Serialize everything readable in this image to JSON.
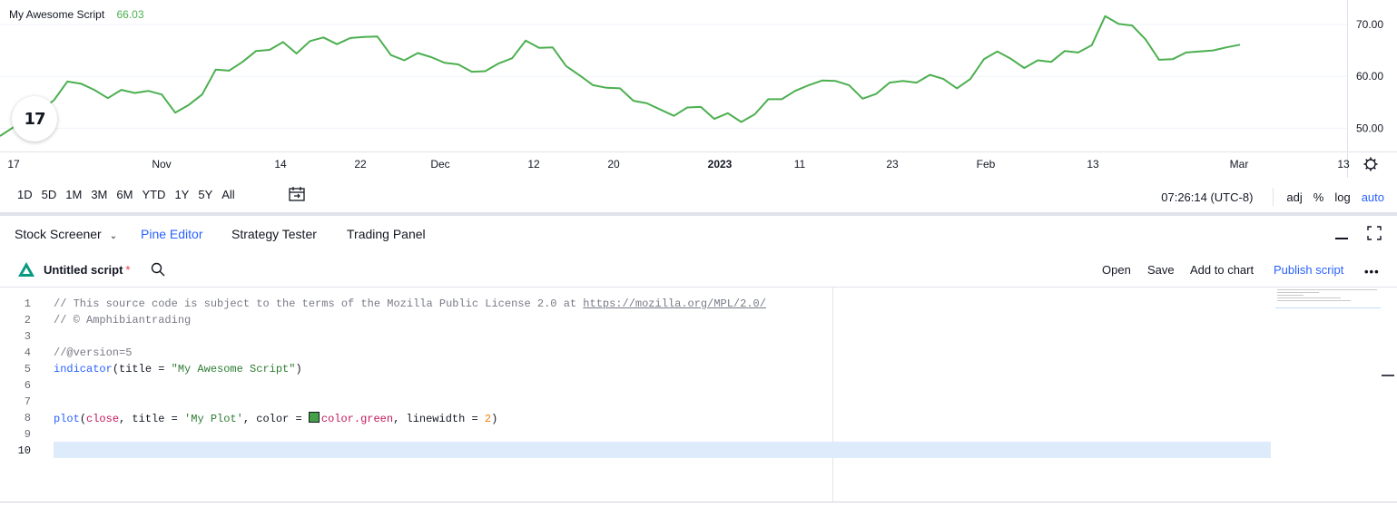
{
  "chart": {
    "indicator_name": "My Awesome Script",
    "indicator_value": "66.03",
    "line_color": "#4caf50",
    "y_ticks": [
      "70.00",
      "60.00",
      "50.00"
    ],
    "x_ticks": [
      "17",
      "Nov",
      "14",
      "22",
      "Dec",
      "12",
      "20",
      "2023",
      "11",
      "23",
      "Feb",
      "13",
      "Mar",
      "13"
    ],
    "logo_text": "17"
  },
  "chart_data": {
    "type": "line",
    "title": "",
    "xlabel": "",
    "ylabel": "",
    "ylim": [
      47,
      73
    ],
    "series": [
      {
        "name": "My Awesome Script",
        "color": "#4caf50",
        "values": [
          48.5,
          50.2,
          51.6,
          53.4,
          55.4,
          59.0,
          58.6,
          57.4,
          55.8,
          57.4,
          56.8,
          57.2,
          56.5,
          53.0,
          54.5,
          56.5,
          61.3,
          61.1,
          62.8,
          64.9,
          65.1,
          66.6,
          64.4,
          66.8,
          67.5,
          66.2,
          67.4,
          67.6,
          67.7,
          64.1,
          63.1,
          64.5,
          63.7,
          62.6,
          62.3,
          60.9,
          61.0,
          62.5,
          63.5,
          66.9,
          65.5,
          65.6,
          62.0,
          60.2,
          58.3,
          57.8,
          57.7,
          55.3,
          54.8,
          53.6,
          52.4,
          54.0,
          54.1,
          51.8,
          52.9,
          51.2,
          52.7,
          55.6,
          55.6,
          57.2,
          58.3,
          59.2,
          59.1,
          58.3,
          55.7,
          56.6,
          58.8,
          59.1,
          58.8,
          60.3,
          59.5,
          57.7,
          59.5,
          63.3,
          64.8,
          63.4,
          61.6,
          63.1,
          62.8,
          64.9,
          64.6,
          66.0,
          71.6,
          70.1,
          69.8,
          67.1,
          63.2,
          63.3,
          64.6,
          64.8,
          65.0,
          65.6,
          66.1
        ]
      }
    ],
    "y_ticks": [
      70,
      60,
      50
    ],
    "x_tick_labels": [
      "17",
      "Nov",
      "14",
      "22",
      "Dec",
      "12",
      "20",
      "2023",
      "11",
      "23",
      "Feb",
      "13",
      "Mar",
      "13"
    ],
    "grid": true,
    "legend": "top-left"
  },
  "range_bar": {
    "periods": [
      "1D",
      "5D",
      "1M",
      "3M",
      "6M",
      "YTD",
      "1Y",
      "5Y",
      "All"
    ],
    "time": "07:26:14 (UTC-8)",
    "options": [
      "adj",
      "%",
      "log"
    ],
    "auto": "auto"
  },
  "tabs": {
    "stock_screener": "Stock Screener",
    "pine_editor": "Pine Editor",
    "strategy_tester": "Strategy Tester",
    "trading_panel": "Trading Panel"
  },
  "editor_toolbar": {
    "title": "Untitled script",
    "modified_marker": "*",
    "open": "Open",
    "save": "Save",
    "add_to_chart": "Add to chart",
    "publish": "Publish script",
    "more": "•••"
  },
  "code": {
    "line_numbers": [
      "1",
      "2",
      "3",
      "4",
      "5",
      "6",
      "7",
      "8",
      "9",
      "10"
    ],
    "l1_comment": "// This source code is subject to the terms of the Mozilla Public License 2.0 at ",
    "l1_url": "https://mozilla.org/MPL/2.0/",
    "l2": "// © Amphibiantrading",
    "l4": "//@version=5",
    "l5_fn": "indicator",
    "l5_a": "(title = ",
    "l5_str": "\"My Awesome Script\"",
    "l5_b": ")",
    "l8_fn": "plot",
    "l8_a": "(",
    "l8_close": "close",
    "l8_b": ", title = ",
    "l8_str": "'My Plot'",
    "l8_c": ", color = ",
    "l8_color": "color.green",
    "l8_d": ", linewidth = ",
    "l8_num": "2",
    "l8_e": ")"
  }
}
